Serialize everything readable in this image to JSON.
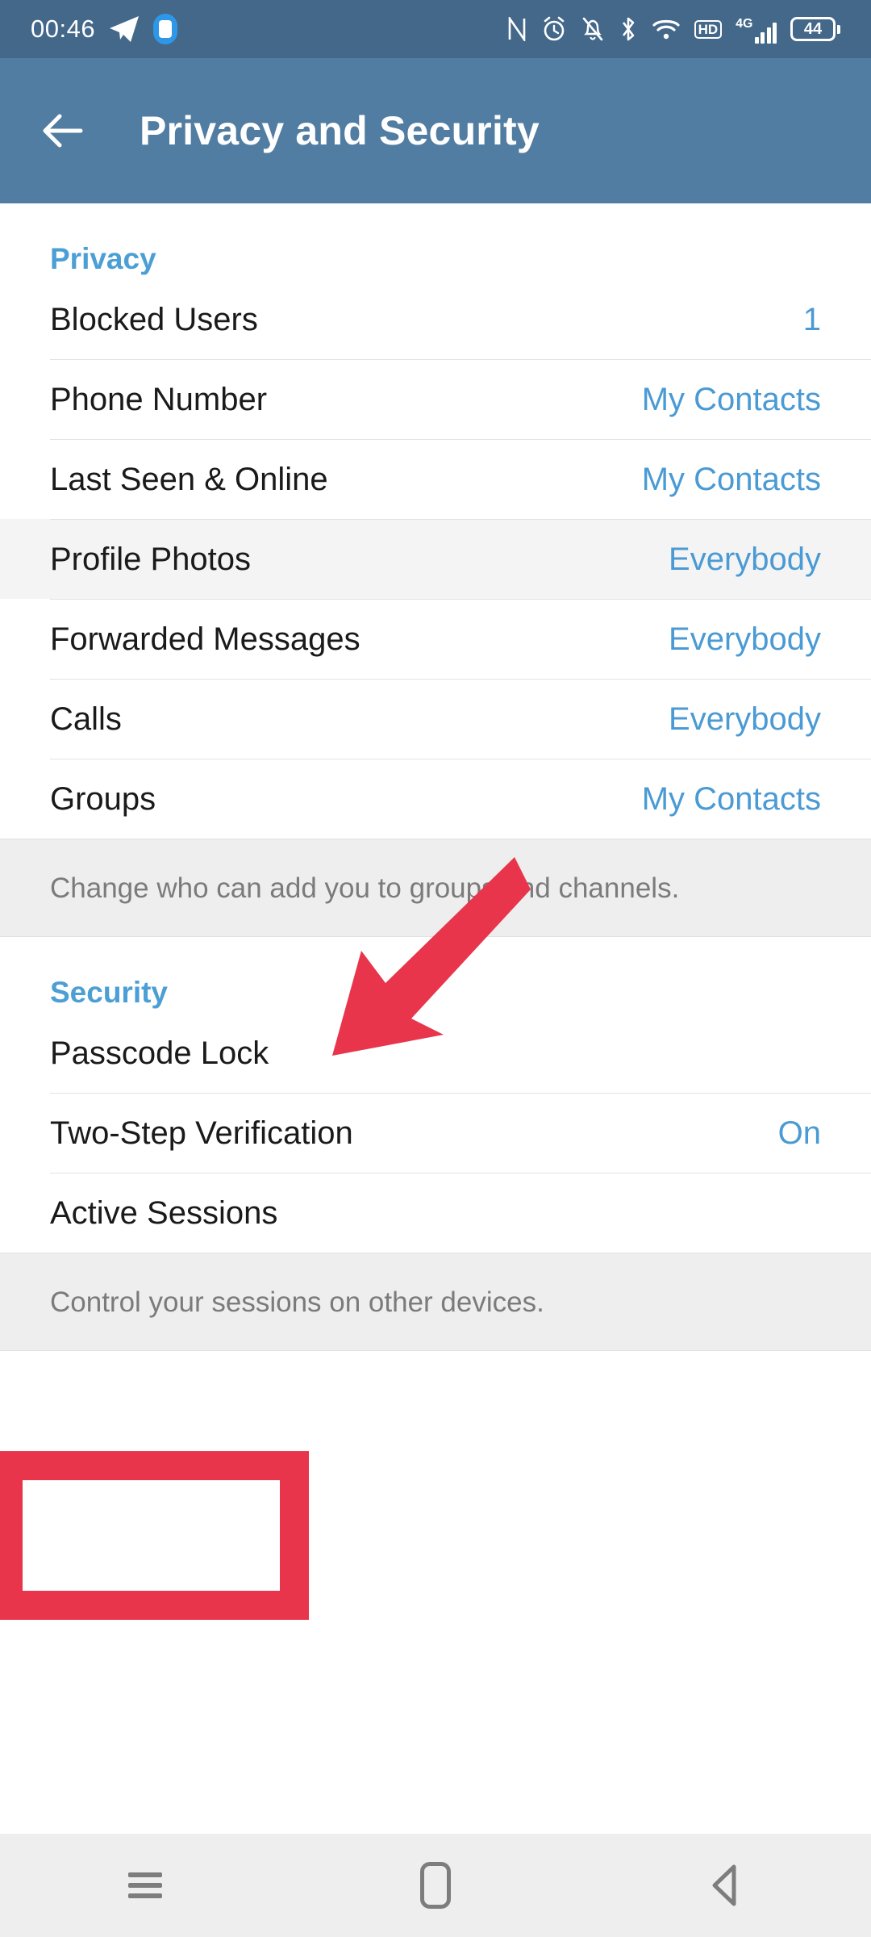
{
  "status_bar": {
    "time": "00:46",
    "battery_percent": "44",
    "network_label": "4G",
    "hd_label": "HD",
    "icons": [
      "nfc-icon",
      "alarm-icon",
      "notifications-muted-icon",
      "bluetooth-icon",
      "wifi-icon",
      "hd-icon",
      "signal-4g-icon",
      "battery-icon"
    ],
    "left_icons": [
      "telegram-icon",
      "screen-record-icon"
    ]
  },
  "app_bar": {
    "title": "Privacy and Security",
    "back_icon": "back-arrow-icon"
  },
  "privacy": {
    "section_title": "Privacy",
    "rows": [
      {
        "label": "Blocked Users",
        "value": "1",
        "highlight": false
      },
      {
        "label": "Phone Number",
        "value": "My Contacts",
        "highlight": false
      },
      {
        "label": "Last Seen & Online",
        "value": "My Contacts",
        "highlight": false
      },
      {
        "label": "Profile Photos",
        "value": "Everybody",
        "highlight": true
      },
      {
        "label": "Forwarded Messages",
        "value": "Everybody",
        "highlight": false
      },
      {
        "label": "Calls",
        "value": "Everybody",
        "highlight": false
      },
      {
        "label": "Groups",
        "value": "My Contacts",
        "highlight": false
      }
    ],
    "note": "Change who can add you to groups and channels."
  },
  "security": {
    "section_title": "Security",
    "rows": [
      {
        "label": "Passcode Lock",
        "value": ""
      },
      {
        "label": "Two-Step Verification",
        "value": "On"
      },
      {
        "label": "Active Sessions",
        "value": ""
      }
    ],
    "note": "Control your sessions on other devices."
  },
  "nav_bar": {
    "buttons": [
      "recents-icon",
      "home-icon",
      "back-icon"
    ]
  },
  "annotation": {
    "highlight_target": "Two-Step Verification",
    "box_color": "#e8354b",
    "arrow_color": "#e8354b"
  },
  "colors": {
    "status_bar_bg": "#44688a",
    "app_bar_bg": "#517da2",
    "accent_blue": "#4a9ad4",
    "section_blue": "#4c9fd4",
    "note_bg": "#eeeeee",
    "row_highlight": "#f4f4f4"
  }
}
